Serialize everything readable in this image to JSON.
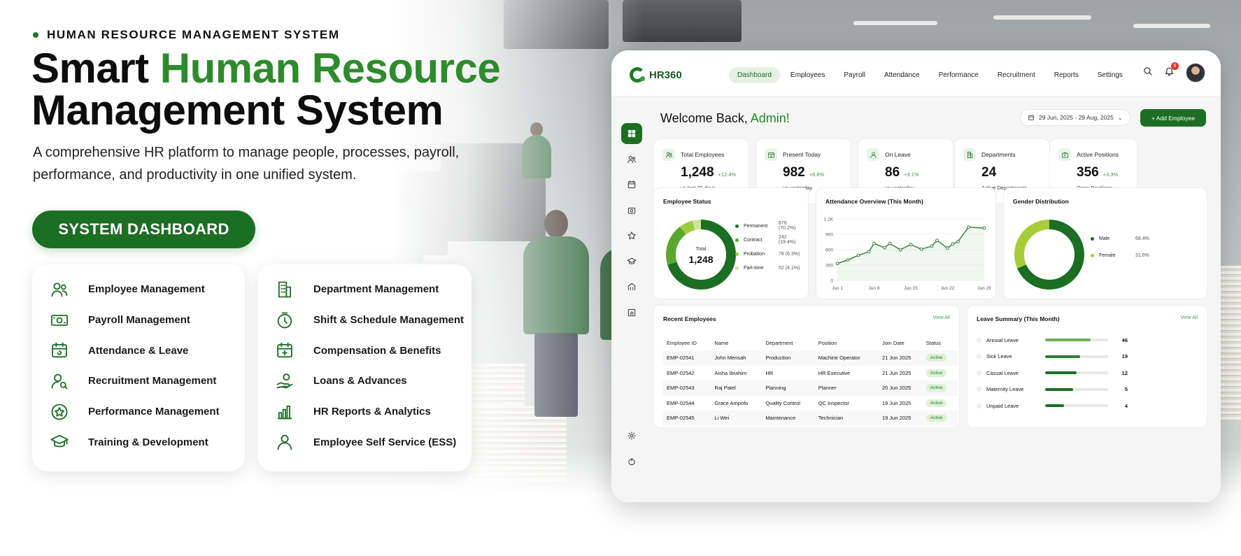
{
  "hero": {
    "eyebrow": "HUMAN RESOURCE MANAGEMENT SYSTEM",
    "headline_part1": "Smart ",
    "headline_green": "Human Resource",
    "headline_line2": "Management System",
    "subtext": "A comprehensive HR platform to manage people, processes, payroll, performance, and productivity in one unified system.",
    "cta_label": "SYSTEM DASHBOARD",
    "accent_color": "#2e8b2c",
    "brand_color": "#1b6e22"
  },
  "features_left": [
    {
      "label": "Employee Management",
      "icon": "users-icon"
    },
    {
      "label": "Payroll Management",
      "icon": "cash-icon"
    },
    {
      "label": "Attendance & Leave",
      "icon": "calendar-icon"
    },
    {
      "label": "Recruitment Management",
      "icon": "user-search-icon"
    },
    {
      "label": "Performance Management",
      "icon": "star-badge-icon"
    },
    {
      "label": "Training & Development",
      "icon": "graduation-cap-icon"
    }
  ],
  "features_right": [
    {
      "label": "Department Management",
      "icon": "building-icon"
    },
    {
      "label": "Shift & Schedule Management",
      "icon": "clock-icon"
    },
    {
      "label": "Compensation & Benefits",
      "icon": "calendar-plus-icon"
    },
    {
      "label": "Loans & Advances",
      "icon": "hand-coin-icon"
    },
    {
      "label": "HR Reports & Analytics",
      "icon": "bar-chart-icon"
    },
    {
      "label": "Employee Self Service (ESS)",
      "icon": "user-icon"
    }
  ],
  "dashboard": {
    "logo": "HR360",
    "nav": [
      "Dashboard",
      "Employees",
      "Payroll",
      "Attendance",
      "Performance",
      "Recruitment",
      "Reports",
      "Settings"
    ],
    "active_nav": "Dashboard",
    "notification_count": "6",
    "welcome_prefix": "Welcome Back, ",
    "welcome_name": "Admin!",
    "date_range": "29 Jun, 2025 - 29 Aug, 2025",
    "add_button": "+ Add Employee",
    "kpis": [
      {
        "label": "Total Employees",
        "value": "1,248",
        "delta": "+12.4%",
        "sub": "vs last 30 days",
        "icon": "users-icon"
      },
      {
        "label": "Present Today",
        "value": "982",
        "delta": "+8.6%",
        "sub": "vs yesterday",
        "icon": "calendar-check-icon"
      },
      {
        "label": "On Leave",
        "value": "86",
        "delta": "+3.1%",
        "sub": "vs yesterday",
        "icon": "user-icon"
      },
      {
        "label": "Departments",
        "value": "24",
        "delta": "",
        "sub": "Active Departments",
        "icon": "building-icon"
      },
      {
        "label": "Active Positions",
        "value": "356",
        "delta": "+3.3%",
        "sub": "Open Positions",
        "icon": "briefcase-icon"
      }
    ],
    "employee_status": {
      "title": "Employee Status",
      "center_label": "Total",
      "center_value": "1,248",
      "items": [
        {
          "name": "Permanent",
          "value": "876 (70.2%)",
          "pct": 70.2,
          "color": "#1b6e22"
        },
        {
          "name": "Contract",
          "value": "242 (19.4%)",
          "pct": 19.4,
          "color": "#5aa72e"
        },
        {
          "name": "Probation",
          "value": "78 (6.3%)",
          "pct": 6.3,
          "color": "#9ccb3c"
        },
        {
          "name": "Part-time",
          "value": "52 (4.1%)",
          "pct": 4.1,
          "color": "#cde39a"
        }
      ]
    },
    "attendance": {
      "title": "Attendance Overview (This Month)"
    },
    "gender": {
      "title": "Gender Distribution",
      "items": [
        {
          "name": "Male",
          "value": "68.4%",
          "pct": 68.4,
          "color": "#1b6e22"
        },
        {
          "name": "Female",
          "value": "31.6%",
          "pct": 31.6,
          "color": "#a6cc3a"
        }
      ]
    },
    "recent": {
      "title": "Recent Employees",
      "view_all": "View All",
      "columns": [
        "Employee ID",
        "Name",
        "Department",
        "Position",
        "Join Date",
        "Status"
      ],
      "rows": [
        [
          "EMP-02541",
          "John Mensah",
          "Production",
          "Machine Operator",
          "21 Jun 2025",
          "Active"
        ],
        [
          "EMP-02542",
          "Aisha Ibrahim",
          "HR",
          "HR Executive",
          "21 Jun 2025",
          "Active"
        ],
        [
          "EMP-02543",
          "Raj Patel",
          "Planning",
          "Planner",
          "20 Jun 2025",
          "Active"
        ],
        [
          "EMP-02544",
          "Grace Ampofo",
          "Quality Control",
          "QC Inspector",
          "19 Jun 2025",
          "Active"
        ],
        [
          "EMP-02545",
          "Li Wei",
          "Maintenance",
          "Technician",
          "19 Jun 2025",
          "Active"
        ]
      ]
    },
    "leave": {
      "title": "Leave Summary (This Month)",
      "view_all": "View All",
      "items": [
        {
          "name": "Annual Leave",
          "count": "46",
          "fill": 0.72,
          "color": "#6cb05a"
        },
        {
          "name": "Sick Leave",
          "count": "19",
          "fill": 0.56,
          "color": "#2d7f33"
        },
        {
          "name": "Casual Leave",
          "count": "12",
          "fill": 0.5,
          "color": "#1b6e22"
        },
        {
          "name": "Maternity Leave",
          "count": "5",
          "fill": 0.44,
          "color": "#1b6e22"
        },
        {
          "name": "Unpaid Leave",
          "count": "4",
          "fill": 0.3,
          "color": "#1b6e22"
        }
      ]
    }
  },
  "chart_data": {
    "type": "line",
    "title": "Attendance Overview (This Month)",
    "x_ticks": [
      "Jun 1",
      "Jun 8",
      "Jun 15",
      "Jun 22",
      "Jun 29"
    ],
    "y_ticks": [
      "0",
      "300",
      "600",
      "900",
      "1.2K"
    ],
    "ylim": [
      0,
      1200
    ],
    "xlim": [
      1,
      29
    ],
    "series": [
      {
        "x": [
          1,
          3,
          5,
          7,
          8,
          10,
          11,
          13,
          15,
          17,
          19,
          20,
          22,
          23,
          24,
          26,
          29
        ],
        "y": [
          330,
          400,
          490,
          560,
          720,
          640,
          720,
          600,
          700,
          610,
          670,
          780,
          630,
          710,
          760,
          1040,
          1020
        ]
      }
    ],
    "grid": true,
    "color": "#2e7d32"
  }
}
